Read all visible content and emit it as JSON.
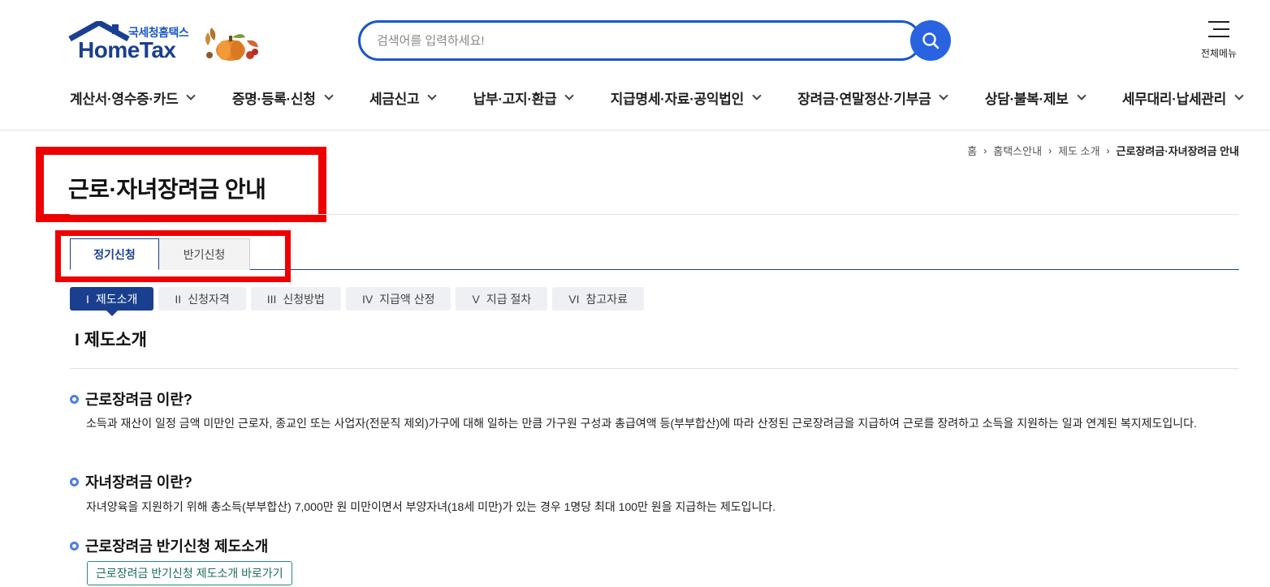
{
  "header": {
    "logo_ko": "국세청홈택스",
    "logo_en": "HomeTax",
    "search_placeholder": "검색어를 입력하세요!",
    "all_menu_label": "전체메뉴"
  },
  "gnb": [
    {
      "label": "계산서·영수증·카드"
    },
    {
      "label": "증명·등록·신청"
    },
    {
      "label": "세금신고"
    },
    {
      "label": "납부·고지·환급"
    },
    {
      "label": "지급명세·자료·공익법인"
    },
    {
      "label": "장려금·연말정산·기부금"
    },
    {
      "label": "상담·불복·제보"
    },
    {
      "label": "세무대리·납세관리"
    }
  ],
  "breadcrumb": {
    "home": "홈",
    "level1": "홈택스안내",
    "level2": "제도 소개",
    "current": "근로장려금·자녀장려금 안내"
  },
  "page_title": "근로·자녀장려금 안내",
  "tabs": {
    "regular": "정기신청",
    "half": "반기신청"
  },
  "subtabs": [
    {
      "roman": "I",
      "label": "제도소개"
    },
    {
      "roman": "II",
      "label": "신청자격"
    },
    {
      "roman": "III",
      "label": "신청방법"
    },
    {
      "roman": "IV",
      "label": "지급액 산정"
    },
    {
      "roman": "V",
      "label": "지급 절차"
    },
    {
      "roman": "VI",
      "label": "참고자료"
    }
  ],
  "section": {
    "title": "I 제도소개",
    "items": [
      {
        "heading": "근로장려금 이란?",
        "body": "소득과 재산이 일정 금액 미만인 근로자, 종교인 또는 사업자(전문직 제외)가구에 대해 일하는 만큼 가구원 구성과 총급여액 등(부부합산)에 따라 산정된 근로장려금을 지급하여 근로를 장려하고 소득을 지원하는 일과 연계된 복지제도입니다."
      },
      {
        "heading": "자녀장려금 이란?",
        "body": "자녀양육을 지원하기 위해 총소득(부부합산) 7,000만 원 미만이면서 부양자녀(18세 미만)가 있는 경우 1명당 최대 100만 원을 지급하는 제도입니다."
      },
      {
        "heading": "근로장려금 반기신청 제도소개",
        "button": "근로장려금 반기신청 제도소개 바로가기"
      }
    ]
  },
  "colors": {
    "primary": "#1a3f8f",
    "search_border": "#1c57c4",
    "search_button": "#2a63e0",
    "highlight_box": "#ee0000"
  }
}
